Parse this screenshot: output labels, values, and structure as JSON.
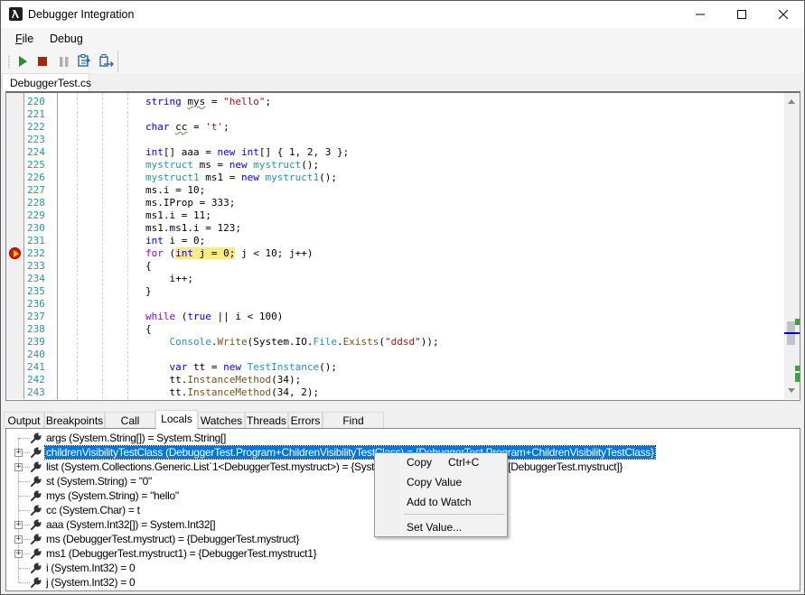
{
  "window": {
    "title": "Debugger Integration",
    "controls": {
      "minimize": "minimize",
      "maximize": "maximize",
      "close": "close"
    }
  },
  "menu": {
    "file_label_underlined": "F",
    "file_label_rest": "ile",
    "debug_label": "Debug"
  },
  "toolbar": {
    "buttons": [
      {
        "name": "start-debugging",
        "icon": "play-icon",
        "color": "#2d8e2d"
      },
      {
        "name": "stop-debugging",
        "icon": "stop-icon",
        "color": "#a1260d"
      },
      {
        "name": "pause",
        "icon": "pause-icon",
        "color": "#b0b0b0"
      },
      {
        "name": "step-into",
        "icon": "step-into-icon",
        "color": "#1e5ea8"
      },
      {
        "name": "step-over",
        "icon": "step-over-icon",
        "color": "#1e5ea8"
      }
    ]
  },
  "document_tab": {
    "label": "DebuggerTest.cs"
  },
  "editor": {
    "current_line": 232,
    "line_numbers": [
      "220",
      "221",
      "222",
      "223",
      "224",
      "225",
      "226",
      "227",
      "228",
      "229",
      "230",
      "231",
      "232",
      "233",
      "234",
      "235",
      "236",
      "237",
      "238",
      "239",
      "240",
      "241",
      "242",
      "243"
    ],
    "lines": [
      "string mys = \"hello\";",
      "",
      "char cc = 't';",
      "",
      "int[] aaa = new int[] { 1, 2, 3 };",
      "mystruct ms = new mystruct();",
      "mystruct1 ms1 = new mystruct1();",
      "ms.i = 10;",
      "ms.IProp = 333;",
      "ms1.i = 11;",
      "ms1.ms1.i = 123;",
      "int i = 0;",
      "for (int j = 0; j < 10; j++)",
      "{",
      "    i++;",
      "}",
      "",
      "while (true || i < 100)",
      "{",
      "    Console.Write(System.IO.File.Exists(\"ddsd\"));",
      "",
      "    var tt = new TestInstance();",
      "    tt.InstanceMethod(34);",
      "    tt.InstanceMethod(34, 2);"
    ],
    "colors": {
      "keyword": "#0000ff",
      "type": "#2b91af",
      "string": "#a31515",
      "method": "#74531f",
      "control": "#8f08c4",
      "highlight": "#fbe98a",
      "line_number": "#2b91af"
    }
  },
  "panel_tabs": [
    {
      "label": "Output",
      "active": false
    },
    {
      "label": "Breakpoints",
      "active": false
    },
    {
      "label": "Call Stack",
      "active": false
    },
    {
      "label": "Locals",
      "active": true
    },
    {
      "label": "Watches",
      "active": false
    },
    {
      "label": "Threads",
      "active": false
    },
    {
      "label": "Errors",
      "active": false
    },
    {
      "label": "Find Results",
      "active": false
    }
  ],
  "locals": [
    {
      "text": "args (System.String[]) = System.String[]",
      "expandable": false,
      "selected": false
    },
    {
      "text": "childrenVisibilityTestClass (DebuggerTest.Program+ChildrenVisibilityTestClass) = {DebuggerTest.Program+ChildrenVisibilityTestClass}",
      "expandable": true,
      "selected": true
    },
    {
      "text": "list (System.Collections.Generic.List`1<DebuggerTest.mystruct>) = {System.Collections.Generic.List`1[DebuggerTest.mystruct]}",
      "expandable": true,
      "selected": false
    },
    {
      "text": "st (System.String) = \"0\"",
      "expandable": false,
      "selected": false
    },
    {
      "text": "mys (System.String) = \"hello\"",
      "expandable": false,
      "selected": false
    },
    {
      "text": "cc (System.Char) = t",
      "expandable": false,
      "selected": false
    },
    {
      "text": "aaa (System.Int32[]) = System.Int32[]",
      "expandable": true,
      "selected": false
    },
    {
      "text": "ms (DebuggerTest.mystruct) = {DebuggerTest.mystruct}",
      "expandable": true,
      "selected": false
    },
    {
      "text": "ms1 (DebuggerTest.mystruct1) = {DebuggerTest.mystruct1}",
      "expandable": true,
      "selected": false
    },
    {
      "text": "i (System.Int32) = 0",
      "expandable": false,
      "selected": false
    },
    {
      "text": "j (System.Int32) = 0",
      "expandable": false,
      "selected": false
    }
  ],
  "context_menu": {
    "items": [
      {
        "label": "Copy",
        "shortcut": "Ctrl+C"
      },
      {
        "label": "Copy Value",
        "shortcut": ""
      },
      {
        "label": "Add to Watch",
        "shortcut": ""
      },
      {
        "label": "Set Value...",
        "shortcut": ""
      }
    ]
  },
  "selection_color": "#0078d7"
}
